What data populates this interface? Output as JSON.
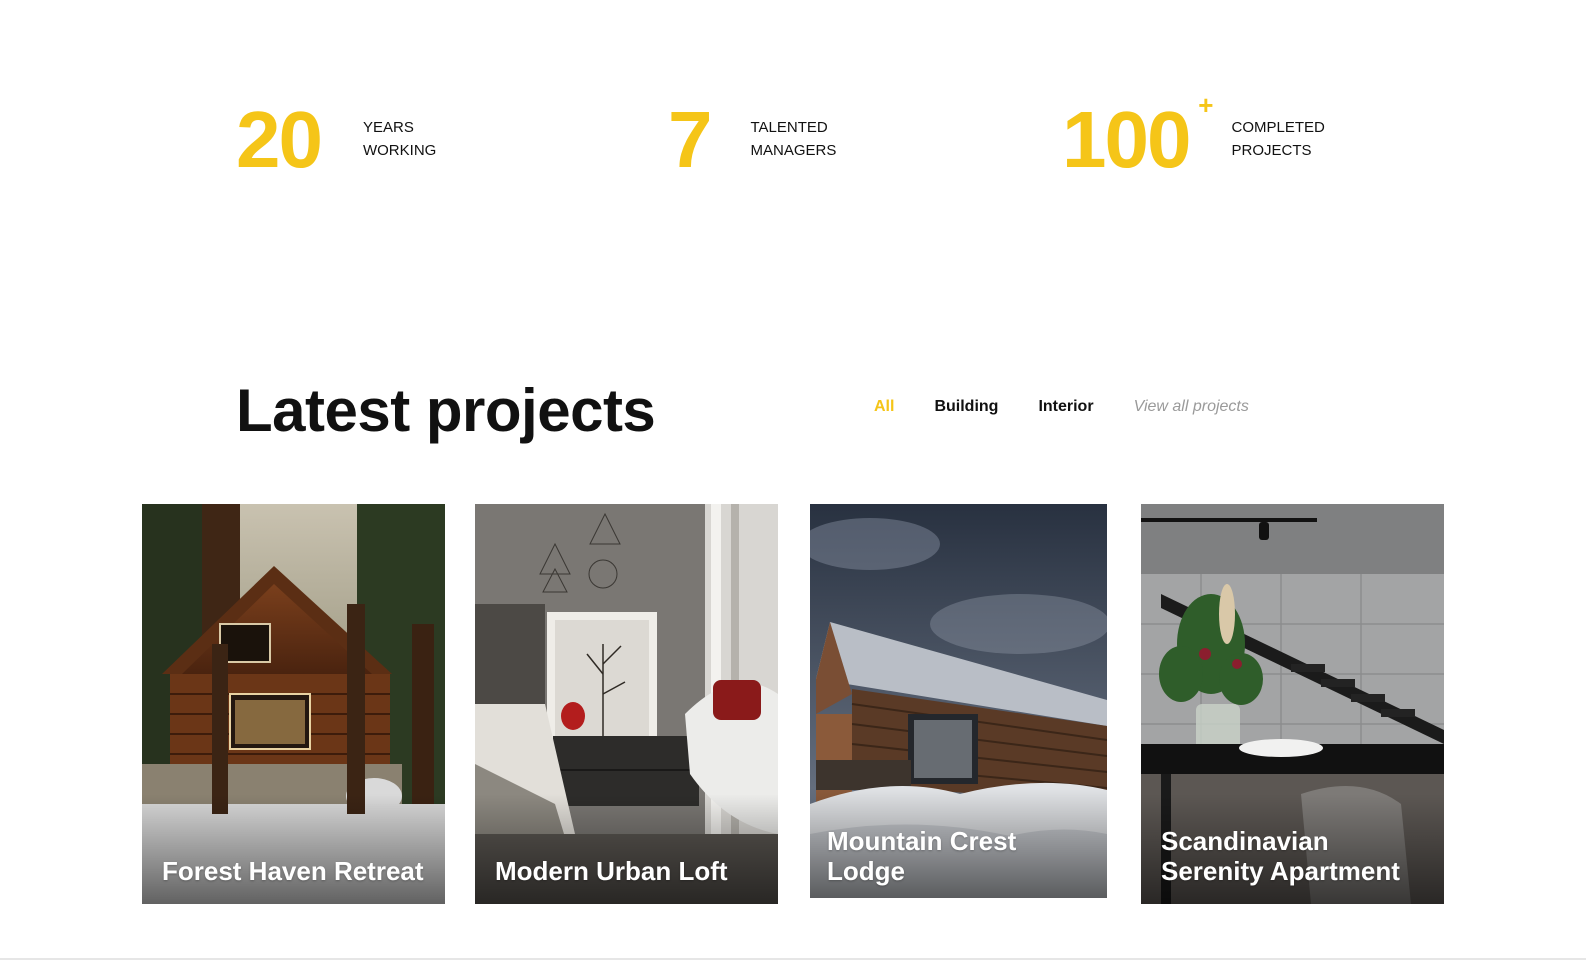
{
  "stats": [
    {
      "number": "20",
      "line1": "YEARS",
      "line2": "WORKING"
    },
    {
      "number": "7",
      "line1": "TALENTED",
      "line2": "MANAGERS"
    },
    {
      "number": "100",
      "suffix": "+",
      "line1": "COMPLETED",
      "line2": "PROJECTS"
    }
  ],
  "projects": {
    "title": "Latest projects",
    "filters": [
      "All",
      "Building",
      "Interior"
    ],
    "active_filter": "All",
    "view_all": "View all projects",
    "cards": [
      {
        "title": "Forest Haven Retreat"
      },
      {
        "title": "Modern Urban Loft"
      },
      {
        "title": "Mountain Crest Lodge"
      },
      {
        "title": "Scandinavian Serenity Apartment"
      }
    ]
  },
  "colors": {
    "accent": "#f5c518",
    "text": "#111111",
    "muted": "#9a9a9a"
  }
}
